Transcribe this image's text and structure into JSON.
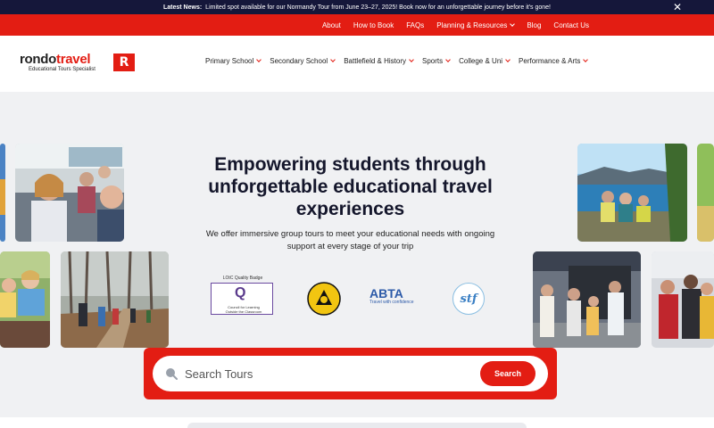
{
  "announcement": {
    "label": "Latest News:",
    "text": "Limited spot available for our Normandy Tour from June 23–27, 2025! Book now for an unforgettable journey before it's gone!",
    "close_glyph": "✕"
  },
  "utility_nav": {
    "items": [
      "About",
      "How to Book",
      "FAQs",
      "Planning & Resources",
      "Blog",
      "Contact Us"
    ]
  },
  "logo": {
    "word1": "rondo",
    "word2": "travel",
    "tagline": "Educational Tours Specialist",
    "mark": "R"
  },
  "main_nav": {
    "items": [
      "Primary School",
      "Secondary School",
      "Battlefield & History",
      "Sports",
      "College & Uni",
      "Performance & Arts"
    ]
  },
  "hero": {
    "headline": "Empowering students through unforgettable educational travel experiences",
    "subtext": "We offer immersive group tours to meet your educational needs with ongoing support at every stage of your trip"
  },
  "accreditations": {
    "loc_title": "LOtC Quality Badge",
    "loc_caption": "Council for Learning Outside the Classroom",
    "abta_name": "ABTA",
    "abta_sub": "Travel with confidence",
    "stf_name": "stf"
  },
  "search": {
    "placeholder": "Search Tours",
    "button_label": "Search"
  },
  "colors": {
    "brand_red": "#e31d13",
    "announcement_bg": "#15173a",
    "heading": "#14162b"
  }
}
